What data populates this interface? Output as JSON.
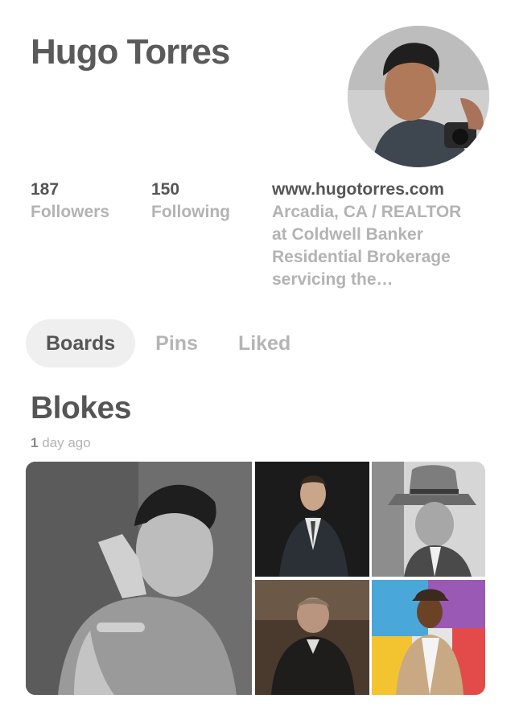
{
  "profile": {
    "name": "Hugo Torres"
  },
  "stats": {
    "followers": {
      "count": "187",
      "label": "Followers"
    },
    "following": {
      "count": "150",
      "label": "Following"
    }
  },
  "bio": {
    "website": "www.hugotorres.com",
    "lines": [
      "Arcadia, CA / REALTOR",
      "at Coldwell Banker",
      "Residential Brokerage",
      "servicing the…"
    ]
  },
  "tabs": [
    {
      "label": "Boards",
      "active": true
    },
    {
      "label": "Pins",
      "active": false
    },
    {
      "label": "Liked",
      "active": false
    }
  ],
  "board": {
    "title": "Blokes",
    "time_count": "1",
    "time_suffix": " day ago"
  }
}
